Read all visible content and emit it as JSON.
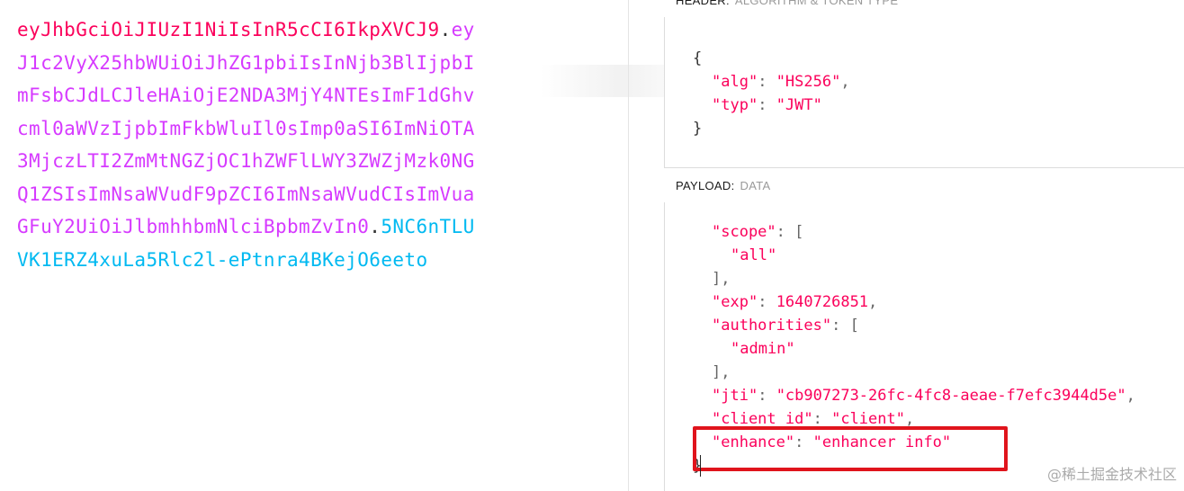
{
  "encoded": {
    "lines": [
      [
        {
          "t": "header",
          "v": "eyJhbGciOiJIUzI1NiIsInR5cCI6IkpXVCJ9"
        },
        {
          "t": "dot",
          "v": "."
        },
        {
          "t": "payload",
          "v": "ey"
        }
      ],
      [
        {
          "t": "payload",
          "v": "J1c2VyX25hbWUiOiJhZG1pbiIsInNjb3BlIjpbI"
        }
      ],
      [
        {
          "t": "payload",
          "v": "mFsbCJdLCJleHAiOjE2NDA3MjY4NTEsImF1dGhv"
        }
      ],
      [
        {
          "t": "payload",
          "v": "cml0aWVzIjpbImFkbWluIl0sImp0aSI6ImNiOTA"
        }
      ],
      [
        {
          "t": "payload",
          "v": "3MjczLTI2ZmMtNGZjOC1hZWFlLWY3ZWZjMzk0NG"
        }
      ],
      [
        {
          "t": "payload",
          "v": "Q1ZSIsImNsaWVudF9pZCI6ImNsaWVudCIsImVua"
        }
      ],
      [
        {
          "t": "payload",
          "v": "GFuY2UiOiJlbmhhbmNlciBpbmZvIn0"
        },
        {
          "t": "dot",
          "v": "."
        },
        {
          "t": "sig",
          "v": "5NC6nTLU"
        }
      ],
      [
        {
          "t": "sig",
          "v": "VK1ERZ4xuLa5Rlc2l-ePtnra4BKejO6eeto"
        }
      ]
    ]
  },
  "header_section": {
    "label": "HEADER:",
    "sub": "ALGORITHM & TOKEN TYPE",
    "lines": [
      {
        "indent": 0,
        "text": "{"
      },
      {
        "indent": 1,
        "text": "\"alg\": \"HS256\","
      },
      {
        "indent": 1,
        "text": "\"typ\": \"JWT\""
      },
      {
        "indent": 0,
        "text": "}"
      }
    ]
  },
  "payload_section": {
    "label": "PAYLOAD:",
    "sub": "DATA",
    "lines": [
      {
        "indent": 1,
        "text": "\"scope\": ["
      },
      {
        "indent": 2,
        "text": "\"all\""
      },
      {
        "indent": 1,
        "text": "],"
      },
      {
        "indent": 1,
        "text": "\"exp\": 1640726851,"
      },
      {
        "indent": 1,
        "text": "\"authorities\": ["
      },
      {
        "indent": 2,
        "text": "\"admin\""
      },
      {
        "indent": 1,
        "text": "],"
      },
      {
        "indent": 1,
        "text": "\"jti\": \"cb907273-26fc-4fc8-aeae-f7efc3944d5e\","
      },
      {
        "indent": 1,
        "text": "\"client_id\": \"client\","
      },
      {
        "indent": 1,
        "text": "\"enhance\": \"enhancer info\""
      },
      {
        "indent": 0,
        "text": "}"
      }
    ]
  },
  "watermark": "@稀土掘金技术社区",
  "colors": {
    "header": "#fb015b",
    "payload": "#d63aff",
    "signature": "#00b9f1",
    "highlight": "#e0141c"
  }
}
